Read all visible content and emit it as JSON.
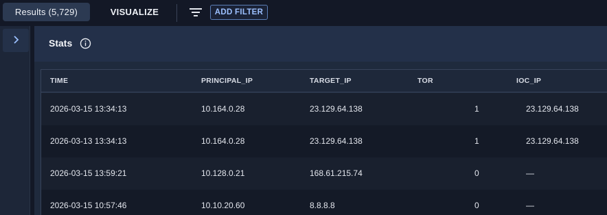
{
  "toolbar": {
    "results_label": "Results (5,729)",
    "visualize_label": "VISUALIZE",
    "add_filter_label": "ADD FILTER"
  },
  "stats": {
    "title": "Stats"
  },
  "table": {
    "columns": [
      "TIME",
      "PRINCIPAL_IP",
      "TARGET_IP",
      "TOR",
      "IOC_IP"
    ],
    "rows": [
      [
        "2026-03-15 13:34:13",
        "10.164.0.28",
        "23.129.64.138",
        "1",
        "23.129.64.138"
      ],
      [
        "2026-03-13 13:34:13",
        "10.164.0.28",
        "23.129.64.138",
        "1",
        "23.129.64.138"
      ],
      [
        "2026-03-15 13:59:21",
        "10.128.0.21",
        "168.61.215.74",
        "0",
        "—"
      ],
      [
        "2026-03-15 10:57:46",
        "10.10.20.60",
        "8.8.8.8",
        "0",
        "—"
      ]
    ]
  },
  "colors": {
    "accent": "#9cc0ff",
    "background": "#131826",
    "panel": "#1f2a3d"
  },
  "icons": [
    "filter-icon",
    "chevron-right-icon",
    "info-icon"
  ]
}
